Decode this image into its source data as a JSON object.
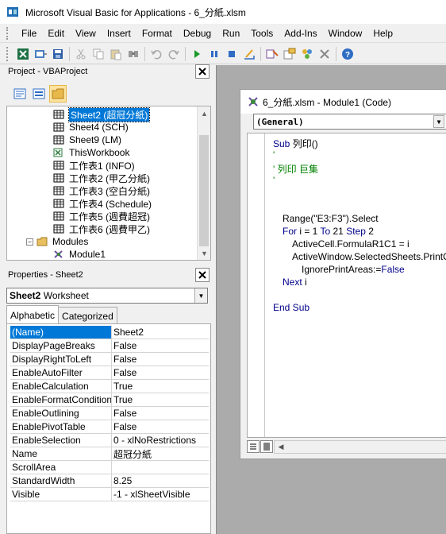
{
  "window": {
    "title": "Microsoft Visual Basic for Applications - 6_分紙.xlsm"
  },
  "menu": [
    "File",
    "Edit",
    "View",
    "Insert",
    "Format",
    "Debug",
    "Run",
    "Tools",
    "Add-Ins",
    "Window",
    "Help"
  ],
  "toolbar_icons": [
    "excel-icon",
    "insert-module-icon",
    "save-icon",
    "cut-icon",
    "copy-icon",
    "paste-icon",
    "find-icon",
    "undo-icon",
    "redo-icon",
    "run-icon",
    "break-icon",
    "reset-icon",
    "design-mode-icon",
    "project-explorer-icon",
    "properties-icon",
    "object-browser-icon",
    "toolbox-icon",
    "help-icon"
  ],
  "project_panel": {
    "title": "Project - VBAProject",
    "tree": [
      {
        "label": "Sheet2 (超冠分紙)",
        "level": 2,
        "kind": "sheet",
        "selected": true
      },
      {
        "label": "Sheet4 (SCH)",
        "level": 2,
        "kind": "sheet"
      },
      {
        "label": "Sheet9 (LM)",
        "level": 2,
        "kind": "sheet"
      },
      {
        "label": "ThisWorkbook",
        "level": 2,
        "kind": "workbook"
      },
      {
        "label": "工作表1 (INFO)",
        "level": 2,
        "kind": "sheet"
      },
      {
        "label": "工作表2 (甲乙分紙)",
        "level": 2,
        "kind": "sheet"
      },
      {
        "label": "工作表3 (空白分紙)",
        "level": 2,
        "kind": "sheet"
      },
      {
        "label": "工作表4 (Schedule)",
        "level": 2,
        "kind": "sheet"
      },
      {
        "label": "工作表5 (週費超冠)",
        "level": 2,
        "kind": "sheet"
      },
      {
        "label": "工作表6 (週費甲乙)",
        "level": 2,
        "kind": "sheet"
      },
      {
        "label": "Modules",
        "level": 1,
        "kind": "folder"
      },
      {
        "label": "Module1",
        "level": 2,
        "kind": "module"
      }
    ]
  },
  "properties_panel": {
    "title": "Properties - Sheet2",
    "object_name": "Sheet2",
    "object_type": "Worksheet",
    "tabs": [
      "Alphabetic",
      "Categorized"
    ],
    "rows": [
      {
        "name": "(Name)",
        "value": "Sheet2"
      },
      {
        "name": "DisplayPageBreaks",
        "value": "False"
      },
      {
        "name": "DisplayRightToLeft",
        "value": "False"
      },
      {
        "name": "EnableAutoFilter",
        "value": "False"
      },
      {
        "name": "EnableCalculation",
        "value": "True"
      },
      {
        "name": "EnableFormatConditionsCalculation",
        "value": "True"
      },
      {
        "name": "EnableOutlining",
        "value": "False"
      },
      {
        "name": "EnablePivotTable",
        "value": "False"
      },
      {
        "name": "EnableSelection",
        "value": "0 - xlNoRestrictions"
      },
      {
        "name": "Name",
        "value": "超冠分紙"
      },
      {
        "name": "ScrollArea",
        "value": ""
      },
      {
        "name": "StandardWidth",
        "value": "8.25"
      },
      {
        "name": "Visible",
        "value": "-1 - xlSheetVisible"
      }
    ]
  },
  "code_window": {
    "title": "6_分紙.xlsm - Module1 (Code)",
    "object_combo": "(General)",
    "lines": [
      {
        "indent": 0,
        "parts": [
          {
            "t": "Sub ",
            "c": "kw"
          },
          {
            "t": "列印()",
            "c": ""
          }
        ]
      },
      {
        "indent": 0,
        "parts": [
          {
            "t": "'",
            "c": "cm"
          }
        ]
      },
      {
        "indent": 0,
        "parts": [
          {
            "t": "' 列印 巨集",
            "c": "cm"
          }
        ]
      },
      {
        "indent": 0,
        "parts": [
          {
            "t": "'",
            "c": "cm"
          }
        ]
      },
      {
        "indent": 0,
        "parts": []
      },
      {
        "indent": 0,
        "parts": []
      },
      {
        "indent": 1,
        "parts": [
          {
            "t": "Range(\"E3:F3\").Select",
            "c": ""
          }
        ]
      },
      {
        "indent": 1,
        "parts": [
          {
            "t": "For ",
            "c": "kw"
          },
          {
            "t": "i = 1 ",
            "c": ""
          },
          {
            "t": "To ",
            "c": "kw"
          },
          {
            "t": "21 ",
            "c": ""
          },
          {
            "t": "Step ",
            "c": "kw"
          },
          {
            "t": "2",
            "c": ""
          }
        ]
      },
      {
        "indent": 2,
        "parts": [
          {
            "t": "ActiveCell.FormulaR1C1 = i",
            "c": ""
          }
        ]
      },
      {
        "indent": 2,
        "parts": [
          {
            "t": "ActiveWindow.SelectedSheets.PrintOut",
            "c": ""
          }
        ]
      },
      {
        "indent": 3,
        "parts": [
          {
            "t": "IgnorePrintAreas:=",
            "c": ""
          },
          {
            "t": "False",
            "c": "kw"
          }
        ]
      },
      {
        "indent": 1,
        "parts": [
          {
            "t": "Next ",
            "c": "kw"
          },
          {
            "t": "i",
            "c": ""
          }
        ]
      },
      {
        "indent": 0,
        "parts": []
      },
      {
        "indent": 0,
        "parts": [
          {
            "t": "End Sub",
            "c": "kw"
          }
        ]
      }
    ]
  }
}
